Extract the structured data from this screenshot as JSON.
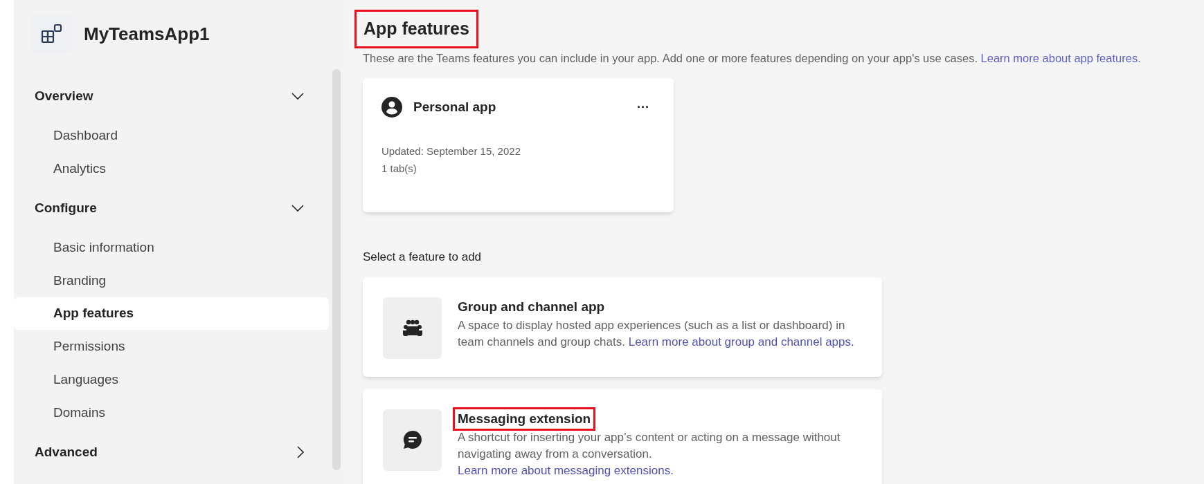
{
  "app": {
    "title": "MyTeamsApp1"
  },
  "sidebar": {
    "sections": [
      {
        "label": "Overview",
        "expanded": true,
        "items": [
          {
            "label": "Dashboard",
            "selected": false
          },
          {
            "label": "Analytics",
            "selected": false
          }
        ]
      },
      {
        "label": "Configure",
        "expanded": true,
        "items": [
          {
            "label": "Basic information",
            "selected": false
          },
          {
            "label": "Branding",
            "selected": false
          },
          {
            "label": "App features",
            "selected": true
          },
          {
            "label": "Permissions",
            "selected": false
          },
          {
            "label": "Languages",
            "selected": false
          },
          {
            "label": "Domains",
            "selected": false
          }
        ]
      },
      {
        "label": "Advanced",
        "expanded": false
      }
    ]
  },
  "page": {
    "title": "App features",
    "title_highlighted": true,
    "description": "These are the Teams features you can include in your app. Add one or more features depending on your app's use cases.",
    "description_link": "Learn more about app features."
  },
  "added_features": [
    {
      "title": "Personal app",
      "more": "···",
      "updated": "Updated: September 15, 2022",
      "count": "1 tab(s)"
    }
  ],
  "select_heading": "Select a feature to add",
  "features": [
    {
      "kind": "group",
      "title": "Group and channel app",
      "highlighted": false,
      "description": "A space to display hosted app experiences (such as a list or dashboard) in team channels and group chats.",
      "link": "Learn more about group and channel apps."
    },
    {
      "kind": "message",
      "title": "Messaging extension",
      "highlighted": true,
      "description": "A shortcut for inserting your app’s content or acting on a message without navigating away from a conversation.",
      "link": "Learn more about messaging extensions."
    }
  ]
}
